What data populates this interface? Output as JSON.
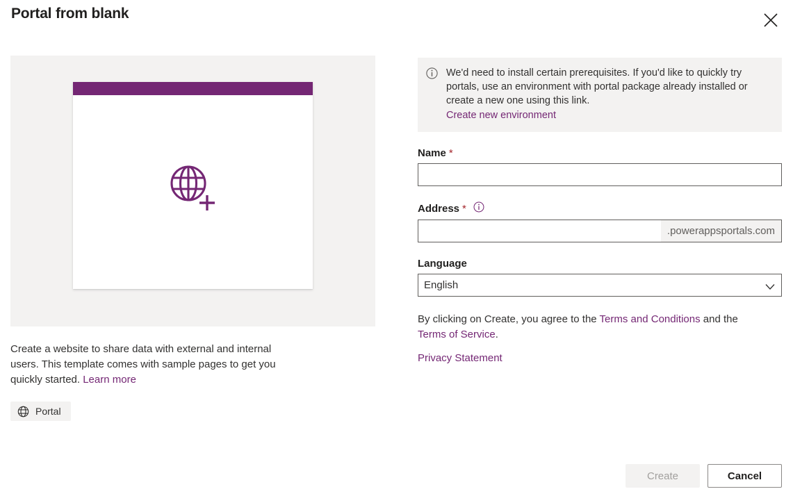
{
  "dialog": {
    "title": "Portal from blank",
    "close_label": "Close"
  },
  "preview": {
    "icon": "globe-plus-icon",
    "bar_color": "#742774",
    "panel_color": "#f3f2f1"
  },
  "template": {
    "description_line1": "Create a website to share data with external and",
    "description_line2": "internal users. This template comes with sample pages",
    "description_line3": "to get you quickly started.",
    "learn_more_label": "Learn more",
    "tag_label": "Portal",
    "tag_icon": "globe-icon"
  },
  "banner": {
    "icon": "info-circle-icon",
    "line1": "We'd need to install certain prerequisites. If you'd like to quickly",
    "line2": "try portals, use an environment with portal package already",
    "line3": "installed or create a new one using this link.",
    "link_label": "Create new environment"
  },
  "form": {
    "name": {
      "label": "Name",
      "required_marker": "*",
      "value": "",
      "placeholder": ""
    },
    "address": {
      "label": "Address",
      "required_marker": "*",
      "info_icon": "info-circle-icon",
      "value": "",
      "placeholder": "",
      "suffix": ".powerappsportals.com"
    },
    "language": {
      "label": "Language",
      "selected": "English",
      "chevron_icon": "chevron-down-icon",
      "options": [
        "English"
      ]
    }
  },
  "legal": {
    "prefix": "By clicking on Create, you agree to the ",
    "terms_and_conditions_label": "Terms and Conditions",
    "middle": " and the ",
    "terms_of_service_label": "Terms of Service",
    "suffix": ".",
    "privacy_statement_label": "Privacy Statement"
  },
  "footer": {
    "create_label": "Create",
    "cancel_label": "Cancel",
    "create_enabled": false
  },
  "colors": {
    "accent_purple": "#742774",
    "link_purple": "#742774",
    "required_red": "#a4262c",
    "neutral_bg": "#f3f2f1"
  }
}
